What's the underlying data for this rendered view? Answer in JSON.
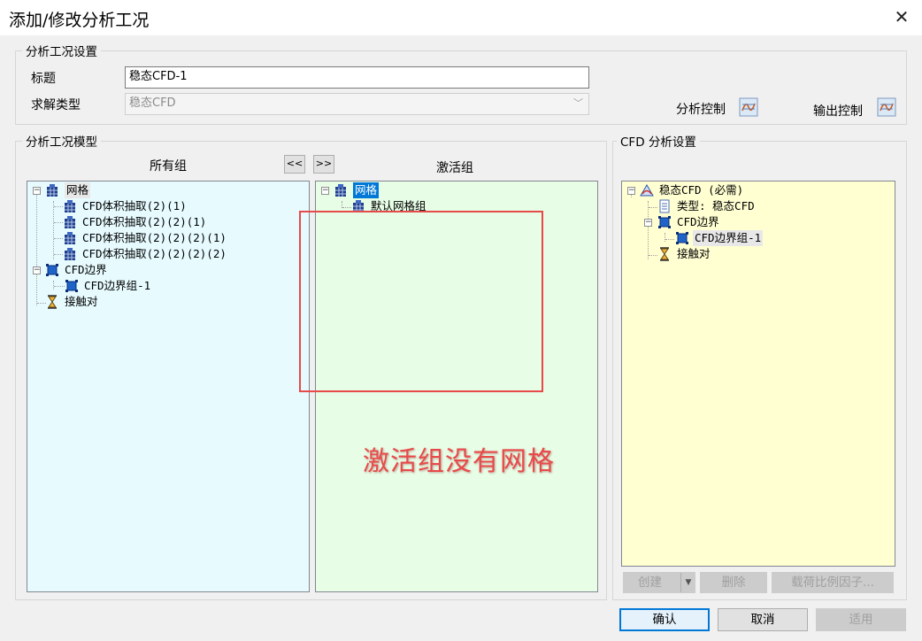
{
  "window": {
    "title": "添加/修改分析工况",
    "close_glyph": "✕"
  },
  "settings": {
    "group_title": "分析工况设置",
    "title_label": "标题",
    "title_value": "稳态CFD-1",
    "solve_type_label": "求解类型",
    "solve_type_value": "稳态CFD",
    "analysis_control_label": "分析控制",
    "output_control_label": "输出控制"
  },
  "model": {
    "group_title": "分析工况模型",
    "all_groups_header": "所有组",
    "active_groups_header": "激活组",
    "move_left_label": "<<",
    "move_right_label": ">>",
    "all_groups_tree": [
      {
        "label": "网格",
        "icon": "mesh-group-icon",
        "level": 0
      },
      {
        "label": "CFD体积抽取(2)(1)",
        "icon": "mesh-group-icon",
        "level": 1
      },
      {
        "label": "CFD体积抽取(2)(2)(1)",
        "icon": "mesh-group-icon",
        "level": 1
      },
      {
        "label": "CFD体积抽取(2)(2)(2)(1)",
        "icon": "mesh-group-icon",
        "level": 1
      },
      {
        "label": "CFD体积抽取(2)(2)(2)(2)",
        "icon": "mesh-group-icon",
        "level": 1
      },
      {
        "label": "CFD边界",
        "icon": "boundary-icon",
        "level": 0
      },
      {
        "label": "CFD边界组-1",
        "icon": "boundary-icon",
        "level": 1
      },
      {
        "label": "接触对",
        "icon": "contact-icon",
        "level": 0
      }
    ],
    "active_groups_tree": [
      {
        "label": "网格",
        "icon": "mesh-group-icon",
        "level": 0
      },
      {
        "label": "默认网格组",
        "icon": "mesh-group-icon",
        "level": 1
      }
    ],
    "annotation_text": "激活组没有网格"
  },
  "cfd": {
    "group_title": "CFD 分析设置",
    "tree": [
      {
        "label": "稳态CFD (必需)",
        "icon": "cfd-analysis-icon",
        "level": 0
      },
      {
        "label": "类型: 稳态CFD",
        "icon": "document-icon",
        "level": 1
      },
      {
        "label": "CFD边界",
        "icon": "boundary-icon",
        "level": 1
      },
      {
        "label": "CFD边界组-1",
        "icon": "boundary-icon",
        "level": 2
      },
      {
        "label": "接触对",
        "icon": "contact-icon",
        "level": 1
      }
    ],
    "create_label": "创建",
    "delete_label": "删除",
    "load_factor_label": "载荷比例因子..."
  },
  "footer": {
    "confirm_label": "确认",
    "cancel_label": "取消",
    "apply_label": "适用"
  },
  "colors": {
    "all_groups_bg": "#e7fbff",
    "active_groups_bg": "#e7fde6",
    "cfd_bg": "#ffffd2",
    "annotation_red": "#e84a4a",
    "selection_blue": "#0078d7"
  }
}
